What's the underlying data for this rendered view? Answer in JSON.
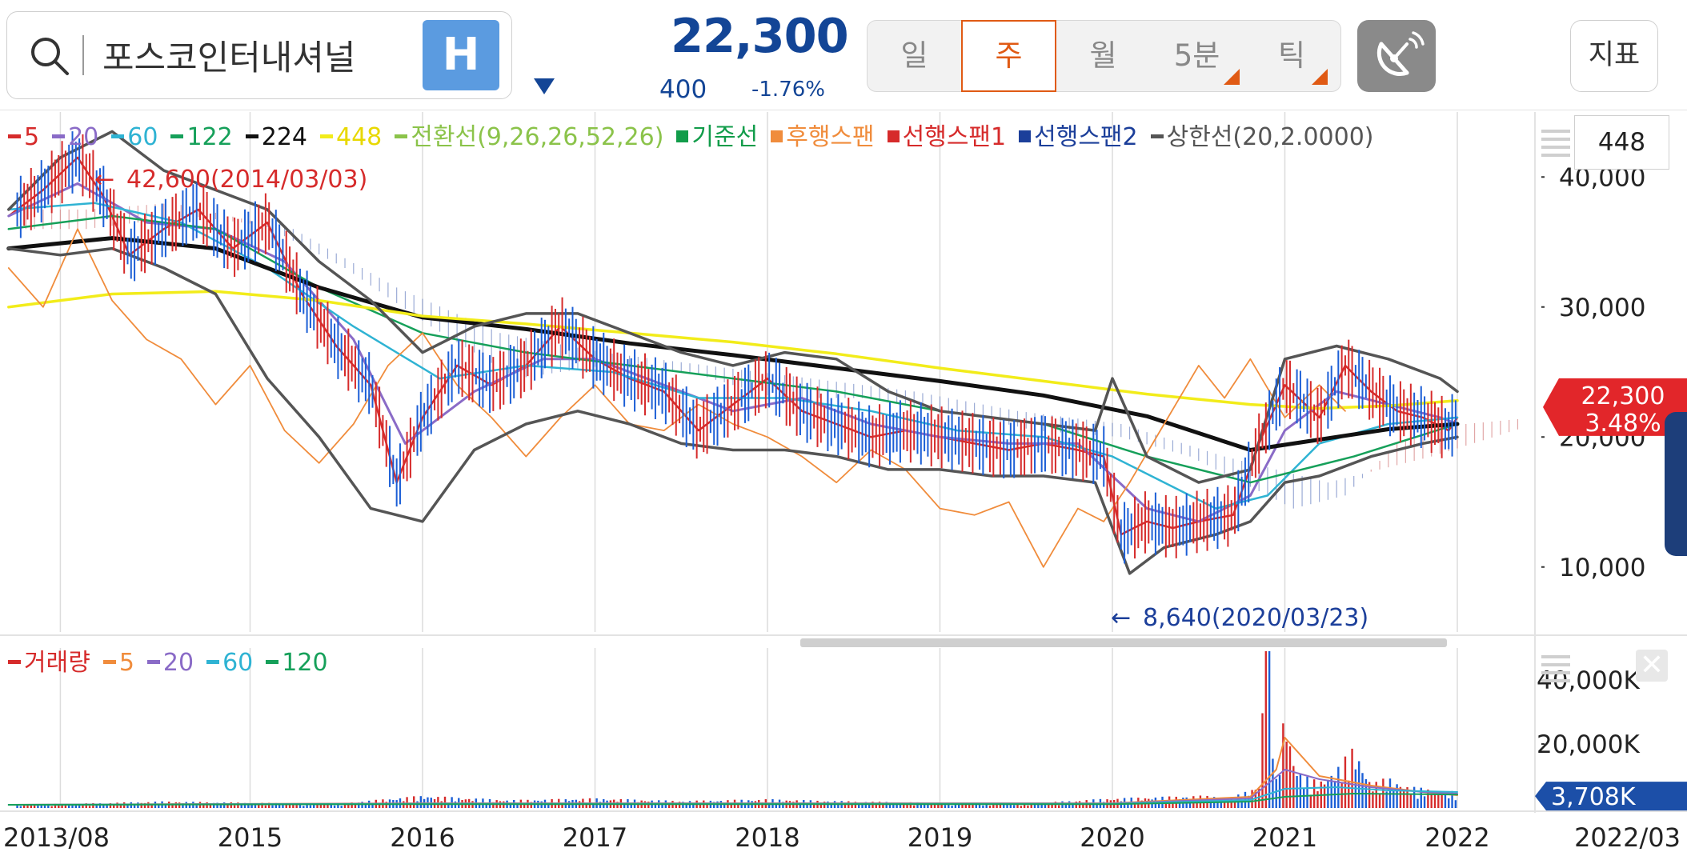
{
  "header": {
    "stock_name": "포스코인터내셔널",
    "badge": "H",
    "price": "22,300",
    "change": "400",
    "change_pct": "-1.76%",
    "periods": [
      {
        "label": "일",
        "active": false,
        "has_flag": false
      },
      {
        "label": "주",
        "active": true,
        "has_flag": false
      },
      {
        "label": "월",
        "active": false,
        "has_flag": false
      },
      {
        "label": "5분",
        "active": false,
        "has_flag": true
      },
      {
        "label": "틱",
        "active": false,
        "has_flag": true
      }
    ],
    "radar_icon": "radar-icon",
    "indicator_label": "지표",
    "accent_color": "#e05a14",
    "price_color": "#134596"
  },
  "price_legend": [
    {
      "label": "5",
      "color": "#d62b2b",
      "marker": "dash"
    },
    {
      "label": "20",
      "color": "#8a6bc7",
      "marker": "dash"
    },
    {
      "label": "60",
      "color": "#2fb3d3",
      "marker": "dash"
    },
    {
      "label": "122",
      "color": "#16a05a",
      "marker": "dash"
    },
    {
      "label": "224",
      "color": "#111111",
      "marker": "dash"
    },
    {
      "label": "448",
      "color": "#f2ec1a",
      "marker": "dash"
    },
    {
      "label": "전환선(9,26,26,52,26)",
      "color": "#8bc34a",
      "marker": "dash"
    },
    {
      "label": "기준선",
      "color": "#119c4a",
      "marker": "square"
    },
    {
      "label": "후행스팬",
      "color": "#f08c3c",
      "marker": "square"
    },
    {
      "label": "선행스팬1",
      "color": "#d62b2b",
      "marker": "square"
    },
    {
      "label": "선행스팬2",
      "color": "#1c3f9a",
      "marker": "square"
    },
    {
      "label": "상한선(20,2.0000)",
      "color": "#555555",
      "marker": "dash"
    }
  ],
  "volume_legend": [
    {
      "label": "거래량",
      "color": "#d62b2b"
    },
    {
      "label": "5",
      "color": "#f08c3c"
    },
    {
      "label": "20",
      "color": "#8a6bc7"
    },
    {
      "label": "60",
      "color": "#2fb3d3"
    },
    {
      "label": "120",
      "color": "#16a05a"
    }
  ],
  "period_input_value": "448",
  "chart_data": {
    "type": "line",
    "x_labels": [
      "2013/08",
      "2015",
      "2016",
      "2017",
      "2018",
      "2019",
      "2020",
      "2021",
      "2022",
      "2022/03"
    ],
    "price_axis": {
      "ticks": [
        "40,000",
        "30,000",
        "20,000",
        "10,000"
      ],
      "tick_values": [
        40000,
        30000,
        20000,
        10000
      ],
      "ylim": [
        5000,
        45000
      ]
    },
    "volume_axis": {
      "ticks": [
        "40,000K",
        "20,000K"
      ],
      "tick_values": [
        40000,
        20000
      ],
      "ylim": [
        0,
        50000
      ]
    },
    "current_price_label": "22,300",
    "current_pct_label": "3.48%",
    "current_price": 22300,
    "current_volume_label": "3,708K",
    "current_volume": 3708,
    "annotations": [
      {
        "text": "42,600(2014/03/03)",
        "date": "2014/03/03",
        "value": 42600,
        "color": "#d62b2b"
      },
      {
        "text": "8,640(2020/03/23)",
        "date": "2020/03/23",
        "value": 8640,
        "color": "#1c3f9a"
      }
    ],
    "x_range": [
      2013.55,
      2022.45
    ],
    "grid": true,
    "series": [
      {
        "name": "5",
        "color": "#d62b2b",
        "x": [
          2013.6,
          2013.8,
          2014.0,
          2014.15,
          2014.3,
          2014.5,
          2014.7,
          2014.9,
          2015.1,
          2015.3,
          2015.5,
          2015.7,
          2015.85,
          2016.0,
          2016.2,
          2016.4,
          2016.6,
          2016.8,
          2017.0,
          2017.2,
          2017.4,
          2017.6,
          2017.8,
          2018.0,
          2018.2,
          2018.4,
          2018.6,
          2018.8,
          2019.0,
          2019.2,
          2019.4,
          2019.6,
          2019.8,
          2019.95,
          2020.05,
          2020.2,
          2020.35,
          2020.5,
          2020.7,
          2020.85,
          2021.0,
          2021.2,
          2021.35,
          2021.5,
          2021.65,
          2021.8,
          2021.95,
          2022.0
        ],
        "y": [
          37000,
          39000,
          41500,
          38500,
          34000,
          36000,
          37500,
          34500,
          36500,
          31000,
          27000,
          24000,
          16500,
          21500,
          25500,
          24000,
          25500,
          28500,
          26000,
          24500,
          23500,
          20500,
          22500,
          24500,
          22000,
          21000,
          20000,
          20500,
          20000,
          19500,
          19000,
          19500,
          19000,
          18500,
          12500,
          13500,
          13000,
          13500,
          14000,
          19500,
          24000,
          21500,
          25500,
          23500,
          22000,
          21500,
          20500,
          21500
        ]
      },
      {
        "name": "20",
        "color": "#8a6bc7",
        "x": [
          2013.6,
          2014.0,
          2014.4,
          2014.8,
          2015.2,
          2015.6,
          2015.9,
          2016.3,
          2016.7,
          2017.0,
          2017.4,
          2017.8,
          2018.2,
          2018.6,
          2019.0,
          2019.4,
          2019.8,
          2020.0,
          2020.2,
          2020.5,
          2020.8,
          2021.0,
          2021.3,
          2021.6,
          2021.9,
          2022.0
        ],
        "y": [
          37000,
          39500,
          36500,
          36000,
          33500,
          27500,
          19500,
          23500,
          26000,
          26000,
          24000,
          22000,
          23000,
          21000,
          20000,
          19500,
          19500,
          17000,
          14500,
          13500,
          15500,
          20500,
          23500,
          22500,
          21500,
          21000
        ]
      },
      {
        "name": "60",
        "color": "#2fb3d3",
        "x": [
          2013.6,
          2014.1,
          2014.6,
          2015.1,
          2015.6,
          2016.1,
          2016.6,
          2017.1,
          2017.6,
          2018.1,
          2018.6,
          2019.1,
          2019.6,
          2020.0,
          2020.3,
          2020.6,
          2020.9,
          2021.2,
          2021.6,
          2022.0
        ],
        "y": [
          37500,
          38000,
          36500,
          33000,
          28500,
          24500,
          25500,
          25000,
          23000,
          23000,
          22000,
          20500,
          20000,
          18500,
          16500,
          14500,
          15500,
          19500,
          21000,
          21500
        ]
      },
      {
        "name": "122",
        "color": "#16a05a",
        "x": [
          2013.6,
          2014.2,
          2014.8,
          2015.4,
          2016.0,
          2016.6,
          2017.2,
          2017.8,
          2018.4,
          2019.0,
          2019.6,
          2020.2,
          2020.8,
          2021.4,
          2022.0
        ],
        "y": [
          36000,
          37000,
          36000,
          31500,
          28000,
          26500,
          25500,
          24500,
          23500,
          22000,
          21000,
          18500,
          16500,
          18500,
          21000
        ]
      },
      {
        "name": "224",
        "color": "#111111",
        "x": [
          2013.6,
          2014.2,
          2014.8,
          2015.4,
          2016.0,
          2016.6,
          2017.2,
          2017.8,
          2018.4,
          2019.0,
          2019.6,
          2020.2,
          2020.8,
          2021.2,
          2021.6,
          2022.0
        ],
        "y": [
          34500,
          35300,
          34500,
          31500,
          29200,
          28300,
          27200,
          26300,
          25300,
          24300,
          23200,
          21600,
          19000,
          19800,
          20600,
          21000
        ]
      },
      {
        "name": "448",
        "color": "#f2ec1a",
        "x": [
          2013.6,
          2014.2,
          2014.8,
          2015.4,
          2016.0,
          2016.6,
          2017.2,
          2017.8,
          2018.4,
          2019.0,
          2019.6,
          2020.2,
          2020.8,
          2021.2,
          2021.6,
          2022.0
        ],
        "y": [
          30000,
          31000,
          31200,
          30500,
          29300,
          28700,
          28000,
          27300,
          26400,
          25300,
          24300,
          23300,
          22500,
          22200,
          22400,
          22800
        ]
      },
      {
        "name": "후행스팬",
        "color": "#f08c3c",
        "x": [
          2013.6,
          2013.8,
          2014.0,
          2014.2,
          2014.4,
          2014.6,
          2014.8,
          2015.0,
          2015.2,
          2015.4,
          2015.6,
          2015.8,
          2016.0,
          2016.2,
          2016.4,
          2016.6,
          2016.8,
          2017.0,
          2017.2,
          2017.4,
          2017.6,
          2017.8,
          2018.0,
          2018.2,
          2018.4,
          2018.6,
          2018.8,
          2019.0,
          2019.2,
          2019.4,
          2019.6,
          2019.8,
          2019.95,
          2020.1,
          2020.3,
          2020.5,
          2020.65,
          2020.8,
          2021.0,
          2021.2,
          2021.35
        ],
        "y": [
          33000,
          30000,
          36000,
          30500,
          27500,
          26000,
          22500,
          25500,
          20500,
          18000,
          21000,
          25500,
          28000,
          24000,
          21500,
          18500,
          21500,
          24000,
          21000,
          20500,
          22500,
          21000,
          20000,
          18500,
          16500,
          19000,
          17500,
          14500,
          14000,
          15000,
          10000,
          14500,
          13500,
          16500,
          21000,
          25500,
          23000,
          26000,
          21500,
          24000,
          22000
        ]
      },
      {
        "name": "상한선(20,2.0000)",
        "color": "#555555",
        "x": [
          2013.6,
          2013.9,
          2014.2,
          2014.5,
          2014.8,
          2015.1,
          2015.4,
          2015.7,
          2016.0,
          2016.3,
          2016.6,
          2016.9,
          2017.2,
          2017.5,
          2017.8,
          2018.1,
          2018.4,
          2018.7,
          2019.0,
          2019.3,
          2019.6,
          2019.9,
          2020.0,
          2020.2,
          2020.5,
          2020.8,
          2021.0,
          2021.3,
          2021.6,
          2021.9,
          2022.0
        ],
        "y": [
          37500,
          41500,
          43500,
          40500,
          39000,
          37500,
          33500,
          30500,
          26500,
          28500,
          29500,
          29500,
          28000,
          26500,
          25500,
          26500,
          26000,
          23500,
          22000,
          21500,
          21000,
          20500,
          24500,
          18500,
          16500,
          17500,
          26000,
          27000,
          26000,
          24500,
          23500
        ]
      },
      {
        "name": "하한선",
        "color": "#555555",
        "x": [
          2013.6,
          2013.9,
          2014.2,
          2014.5,
          2014.8,
          2015.1,
          2015.4,
          2015.7,
          2016.0,
          2016.3,
          2016.6,
          2016.9,
          2017.2,
          2017.5,
          2017.8,
          2018.1,
          2018.4,
          2018.7,
          2019.0,
          2019.3,
          2019.6,
          2019.9,
          2020.1,
          2020.3,
          2020.6,
          2020.8,
          2021.0,
          2021.2,
          2021.5,
          2021.8,
          2022.0
        ],
        "y": [
          34500,
          34000,
          34500,
          33000,
          31000,
          24500,
          20000,
          14500,
          13500,
          19000,
          21000,
          22000,
          21000,
          19500,
          19000,
          19000,
          18500,
          17500,
          17500,
          17000,
          17000,
          16500,
          9500,
          11500,
          12500,
          13500,
          16500,
          17000,
          18500,
          19500,
          20000
        ]
      }
    ],
    "volume_series": {
      "name": "거래량",
      "color": "#d62b2b",
      "x": [
        2013.6,
        2014.0,
        2014.5,
        2015.0,
        2015.5,
        2016.0,
        2016.5,
        2017.0,
        2017.5,
        2018.0,
        2018.5,
        2019.0,
        2019.5,
        2020.0,
        2020.5,
        2020.7,
        2020.8,
        2020.85,
        2020.9,
        2020.95,
        2021.0,
        2021.05,
        2021.1,
        2021.2,
        2021.3,
        2021.4,
        2021.5,
        2021.6,
        2021.7,
        2021.8,
        2021.9,
        2022.0
      ],
      "y": [
        800,
        1000,
        1500,
        1200,
        1000,
        2800,
        1800,
        2200,
        1600,
        2000,
        1500,
        1200,
        1000,
        2200,
        2800,
        2500,
        4200,
        5500,
        49000,
        6500,
        23000,
        11000,
        7500,
        6000,
        9000,
        14000,
        5500,
        7000,
        5000,
        4500,
        4000,
        3700
      ]
    },
    "volume_ma_series": [
      {
        "name": "5",
        "color": "#f08c3c",
        "x": [
          2013.6,
          2016.0,
          2018.0,
          2020.0,
          2020.8,
          2020.95,
          2021.0,
          2021.2,
          2021.5,
          2021.8,
          2022.0
        ],
        "y": [
          1000,
          1500,
          1500,
          1500,
          3500,
          12000,
          22000,
          10000,
          7000,
          5000,
          4000
        ]
      },
      {
        "name": "20",
        "color": "#8a6bc7",
        "x": [
          2013.6,
          2016.0,
          2018.0,
          2020.0,
          2020.8,
          2021.0,
          2021.2,
          2021.5,
          2021.8,
          2022.0
        ],
        "y": [
          1000,
          1400,
          1400,
          1400,
          3000,
          12000,
          9000,
          6500,
          5000,
          4500
        ]
      },
      {
        "name": "60",
        "color": "#2fb3d3",
        "x": [
          2013.6,
          2016.0,
          2018.0,
          2020.0,
          2020.8,
          2021.0,
          2021.3,
          2021.6,
          2022.0
        ],
        "y": [
          1000,
          1300,
          1300,
          1300,
          2500,
          6000,
          6500,
          5500,
          5000
        ]
      },
      {
        "name": "120",
        "color": "#16a05a",
        "x": [
          2013.6,
          2016.0,
          2018.0,
          2020.0,
          2020.8,
          2021.0,
          2021.4,
          2022.0
        ],
        "y": [
          1000,
          1200,
          1200,
          1200,
          2000,
          3500,
          4500,
          4200
        ]
      }
    ]
  }
}
